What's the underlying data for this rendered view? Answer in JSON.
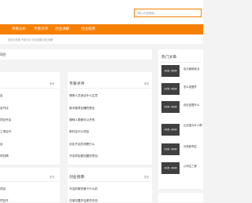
{
  "search": {
    "placeholder": "输入内容搜索..."
  },
  "nav": {
    "items": [
      "项目分析",
      "专家点评",
      "创业详解",
      "创业指南"
    ]
  },
  "breadcrumb": "创业分析网 专家点评·创业指南·创业详解",
  "sidebar_strip": {
    "label": "项目"
  },
  "hot": {
    "title": "热门文章",
    "thumb_caption": "创业第一桶金网",
    "items": [
      "百大营销创业",
      "怎么加盟开",
      "创业加盟什么",
      "比亚迪为什人职",
      "分析影响生",
      "公司注三家"
    ]
  },
  "left_col": {
    "more": "更多",
    "items": [
      "目",
      "目开店",
      "项目开店",
      "工项目开",
      "目",
      "项目揭",
      "项目"
    ]
  },
  "experts": {
    "title": "专家点评",
    "more": "更多",
    "items": [
      "哪家人员适合什么生意",
      "新手做项目赚的是否",
      "哪种人群都可以开的",
      "刚开店什么项目",
      "创业开店的领是什么",
      "开店项目都加盟的项目",
      "创业者可开的是多"
    ]
  },
  "guide": {
    "title": "创业指南",
    "more": "更多",
    "items": [
      "开店的那些事干什么的",
      "在家加盟开店那些东西"
    ]
  },
  "left_col_bottom": {
    "more": "更多",
    "items": [
      "项目",
      "项目开"
    ]
  }
}
